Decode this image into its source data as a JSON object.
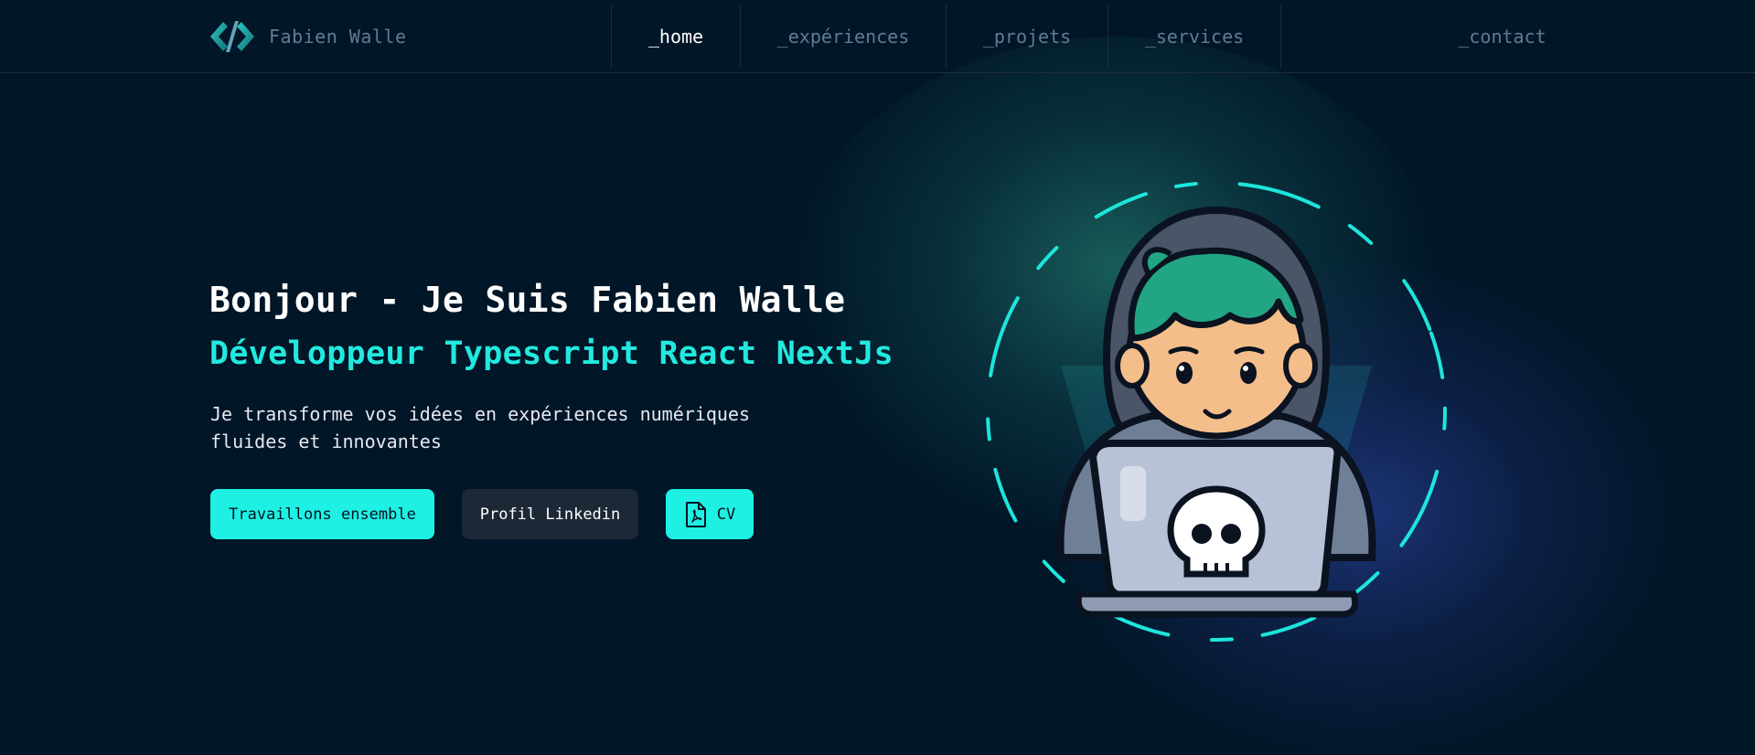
{
  "brand": {
    "name": "Fabien Walle",
    "logo_icon": "code-brackets-icon"
  },
  "nav": {
    "items": [
      {
        "label": "_home",
        "active": true
      },
      {
        "label": "_expériences",
        "active": false
      },
      {
        "label": "_projets",
        "active": false
      },
      {
        "label": "_services",
        "active": false
      }
    ],
    "contact": "_contact"
  },
  "hero": {
    "title": "Bonjour - Je Suis Fabien Walle",
    "subtitle": "Développeur Typescript React NextJs",
    "description": "Je transforme vos idées en expériences numériques fluides et innovantes",
    "buttons": {
      "primary": "Travaillons ensemble",
      "linkedin": "Profil Linkedin",
      "cv": "CV",
      "cv_icon": "pdf-file-icon"
    }
  },
  "illustration": {
    "name": "hooded-developer-laptop-skull-illustration"
  },
  "colors": {
    "background": "#011627",
    "accent": "#1EF0E3",
    "nav_text": "#607B96",
    "border": "#1E2D3D"
  }
}
